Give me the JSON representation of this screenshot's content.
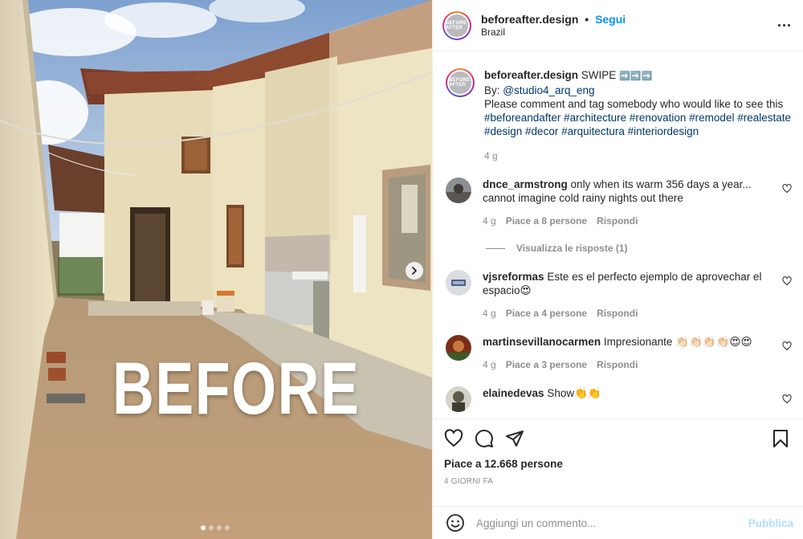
{
  "post": {
    "author": "beforeafter.design",
    "follow_separator": "•",
    "follow_label": "Segui",
    "location": "Brazil",
    "avatar_text": "BEFORE AFTER",
    "overlay_text": "BEFORE",
    "carousel": {
      "slides": 4,
      "current": 1
    }
  },
  "caption": {
    "author": "beforeafter.design",
    "text_head": "SWIPE",
    "arrows": "➡️➡️➡️",
    "by_prefix": "By: ",
    "by_handle": "@studio4_arq_eng",
    "line": "Please comment and tag somebody who would like to see this",
    "hashtags": "#beforeandafter #architecture #renovation #remodel #realestate #design #decor #arquitectura #interiordesign",
    "time": "4 g"
  },
  "comments": [
    {
      "user": "dnce_armstrong",
      "text": "only when its warm 356 days a year... cannot imagine cold rainy nights out there",
      "time": "4 g",
      "likes": "Piace a 8 persone",
      "reply": "Rispondi",
      "view_replies": "Visualizza le risposte (1)",
      "avatar_color": "#6e6a64"
    },
    {
      "user": "vjsreformas",
      "text": "Este es el perfecto ejemplo de aprovechar el espacio😍",
      "time": "4 g",
      "likes": "Piace a 4 persone",
      "reply": "Rispondi",
      "avatar_color": "#d8d8dc"
    },
    {
      "user": "martinsevillanocarmen",
      "text": "Impresionante 👏🏻👏🏻👏🏻👏🏻😍😍",
      "time": "4 g",
      "likes": "Piace a 3 persone",
      "reply": "Rispondi",
      "avatar_color": "#8a3a1e"
    },
    {
      "user": "elainedevas",
      "text": "Show👏👏",
      "avatar_color": "#6b6a5a"
    }
  ],
  "footer": {
    "likes": "Piace a 12.668 persone",
    "posted": "4 GIORNI FA",
    "comment_placeholder": "Aggiungi un commento...",
    "publish_label": "Pubblica"
  },
  "icons": [
    "heart-icon",
    "comment-icon",
    "share-icon",
    "bookmark-icon",
    "emoji-icon",
    "more-icon",
    "chevron-right-icon"
  ]
}
